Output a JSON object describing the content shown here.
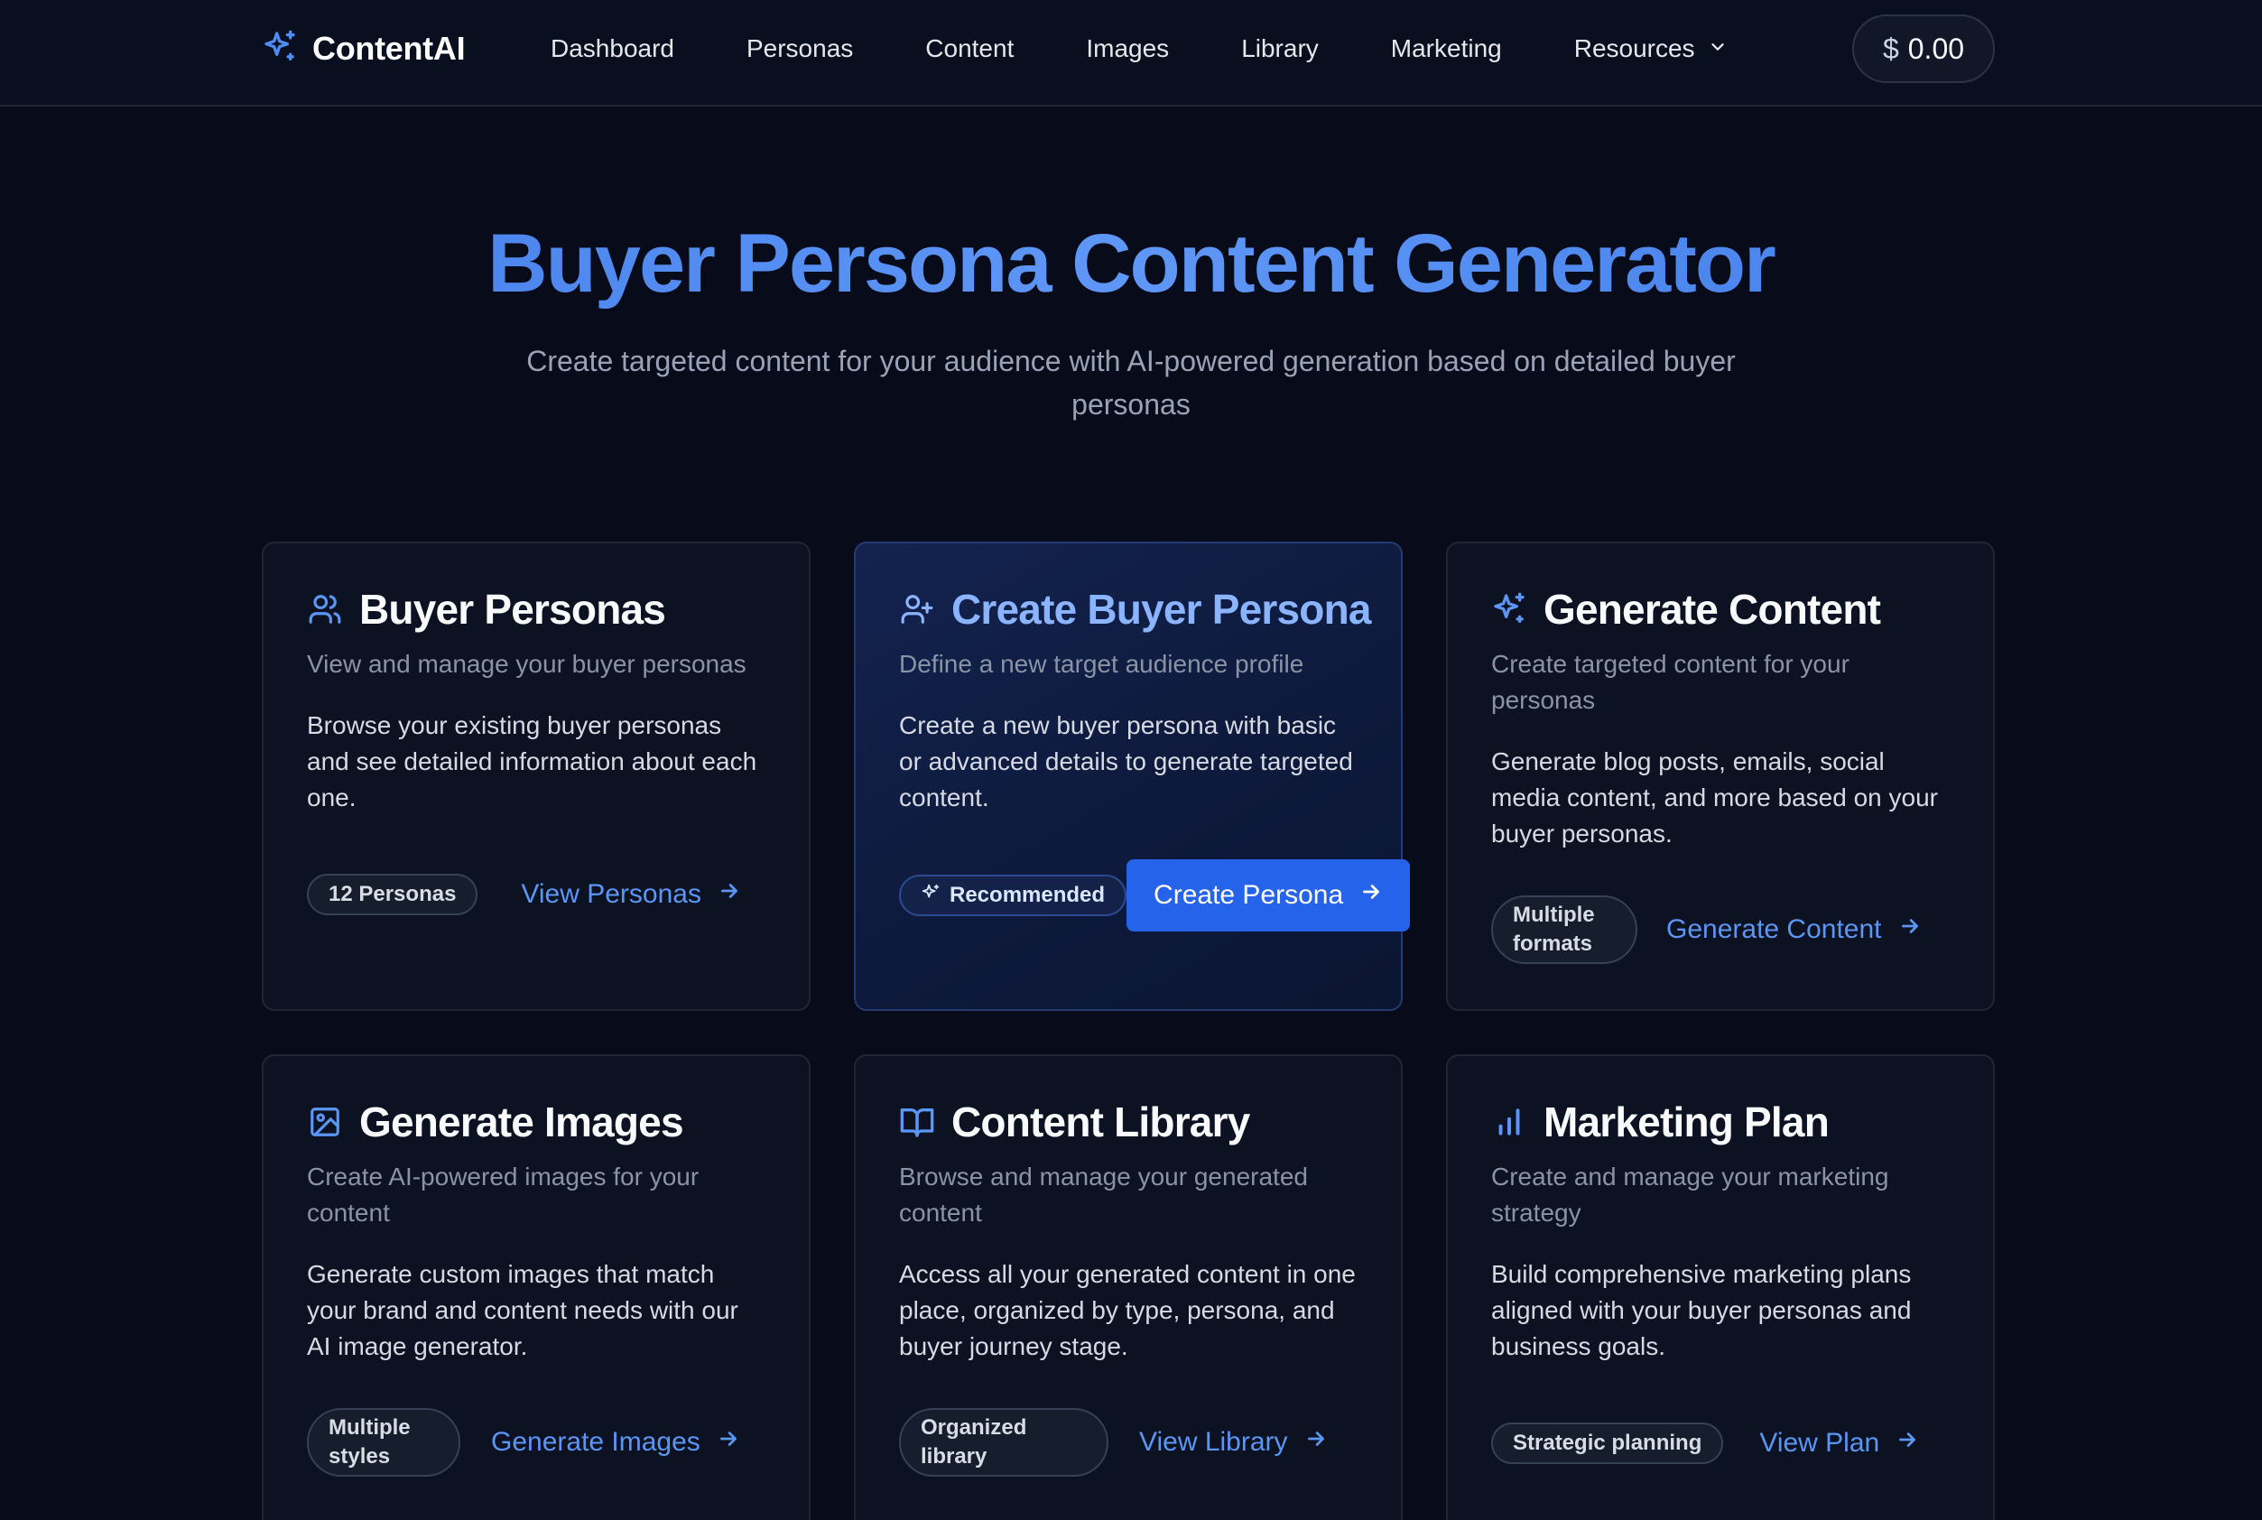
{
  "app": {
    "name": "ContentAI",
    "balance": "0.00",
    "currency_symbol": "$"
  },
  "nav": {
    "items": [
      {
        "label": "Dashboard"
      },
      {
        "label": "Personas"
      },
      {
        "label": "Content"
      },
      {
        "label": "Images"
      },
      {
        "label": "Library"
      },
      {
        "label": "Marketing"
      },
      {
        "label": "Resources",
        "has_dropdown": true,
        "icon": "chevron-down-icon"
      }
    ]
  },
  "hero": {
    "title": "Buyer Persona Content Generator",
    "subtitle": "Create targeted content for your audience with AI-powered generation based on detailed buyer personas"
  },
  "cards": [
    {
      "icon": "users-icon",
      "title": "Buyer Personas",
      "subtitle": "View and manage your buyer personas",
      "body": "Browse your existing buyer personas and see detailed information about each one.",
      "badge": "12 Personas",
      "action": "View Personas"
    },
    {
      "icon": "user-plus-icon",
      "title": "Create Buyer Persona",
      "subtitle": "Define a new target audience profile",
      "body": "Create a new buyer persona with basic or advanced details to generate targeted content.",
      "badge": "Recommended",
      "action": "Create Persona",
      "featured": true
    },
    {
      "icon": "sparkles-icon",
      "title": "Generate Content",
      "subtitle": "Create targeted content for your personas",
      "body": "Generate blog posts, emails, social media content, and more based on your buyer personas.",
      "badge": "Multiple formats",
      "action": "Generate Content"
    },
    {
      "icon": "image-icon",
      "title": "Generate Images",
      "subtitle": "Create AI-powered images for your content",
      "body": "Generate custom images that match your brand and content needs with our AI image generator.",
      "badge": "Multiple styles",
      "action": "Generate Images"
    },
    {
      "icon": "book-open-icon",
      "title": "Content Library",
      "subtitle": "Browse and manage your generated content",
      "body": "Access all your generated content in one place, organized by type, persona, and buyer journey stage.",
      "badge": "Organized library",
      "action": "View Library"
    },
    {
      "icon": "bar-chart-icon",
      "title": "Marketing Plan",
      "subtitle": "Create and manage your marketing strategy",
      "body": "Build comprehensive marketing plans aligned with your buyer personas and business goals.",
      "badge": "Strategic planning",
      "action": "View Plan"
    }
  ],
  "colors": {
    "background": "#070b1a",
    "accent": "#2563eb",
    "link": "#5b95f5",
    "title_gradient": "#4f8bf5"
  }
}
